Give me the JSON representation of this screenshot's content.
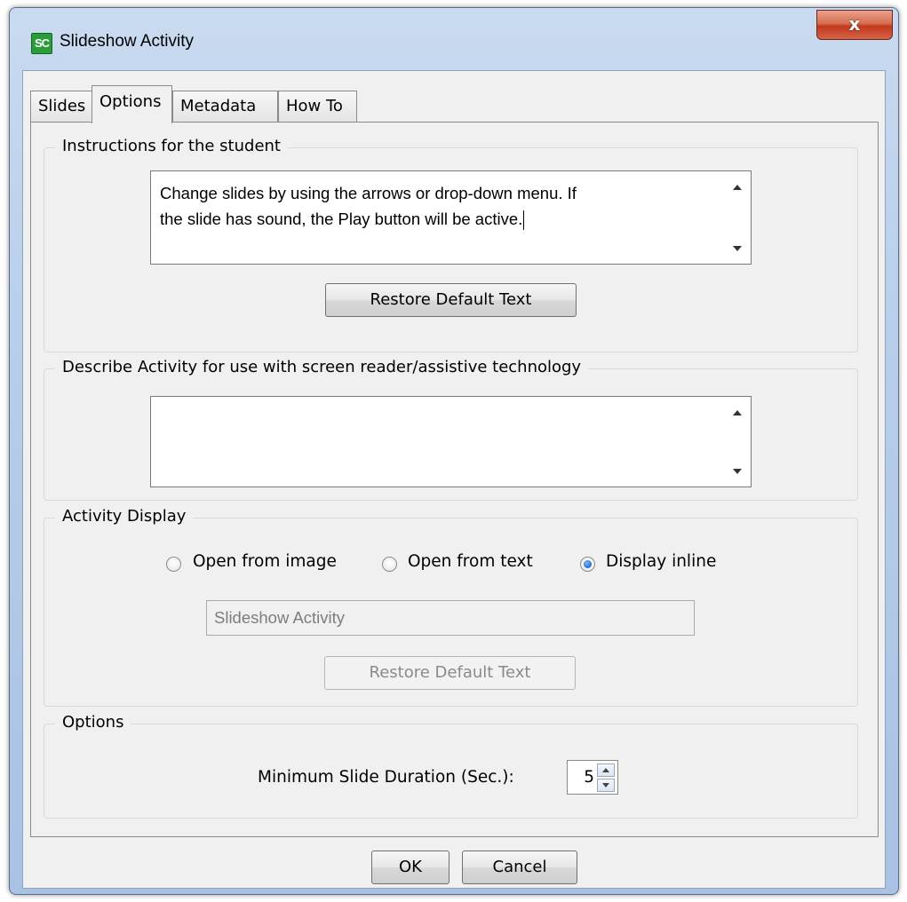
{
  "window": {
    "title": "Slideshow Activity",
    "app_icon_text": "SC",
    "close_glyph": "x"
  },
  "tabs": [
    {
      "label": "Slides",
      "active": false
    },
    {
      "label": "Options",
      "active": true
    },
    {
      "label": "Metadata",
      "active": false
    },
    {
      "label": "How To",
      "active": false
    }
  ],
  "instructions": {
    "legend": "Instructions for the student",
    "text_line1": "Change slides by using the arrows or drop-down menu. If",
    "text_line2": "the slide has sound, the Play button will be active.",
    "restore_label": "Restore Default Text"
  },
  "describe": {
    "legend": "Describe Activity for use with screen reader/assistive technology",
    "text": ""
  },
  "display": {
    "legend": "Activity Display",
    "options": [
      {
        "label": "Open from image",
        "checked": false
      },
      {
        "label": "Open from text",
        "checked": false
      },
      {
        "label": "Display inline",
        "checked": true
      }
    ],
    "text_value": "Slideshow Activity",
    "restore_label": "Restore Default Text"
  },
  "options": {
    "legend": "Options",
    "min_duration_label": "Minimum Slide Duration (Sec.):",
    "min_duration_value": "5"
  },
  "footer": {
    "ok_label": "OK",
    "cancel_label": "Cancel"
  },
  "colors": {
    "titlebar": "#b7cde9",
    "close_button": "#c2391b",
    "app_icon": "#2a9d3a",
    "radio_checked": "#1b5fc8"
  }
}
